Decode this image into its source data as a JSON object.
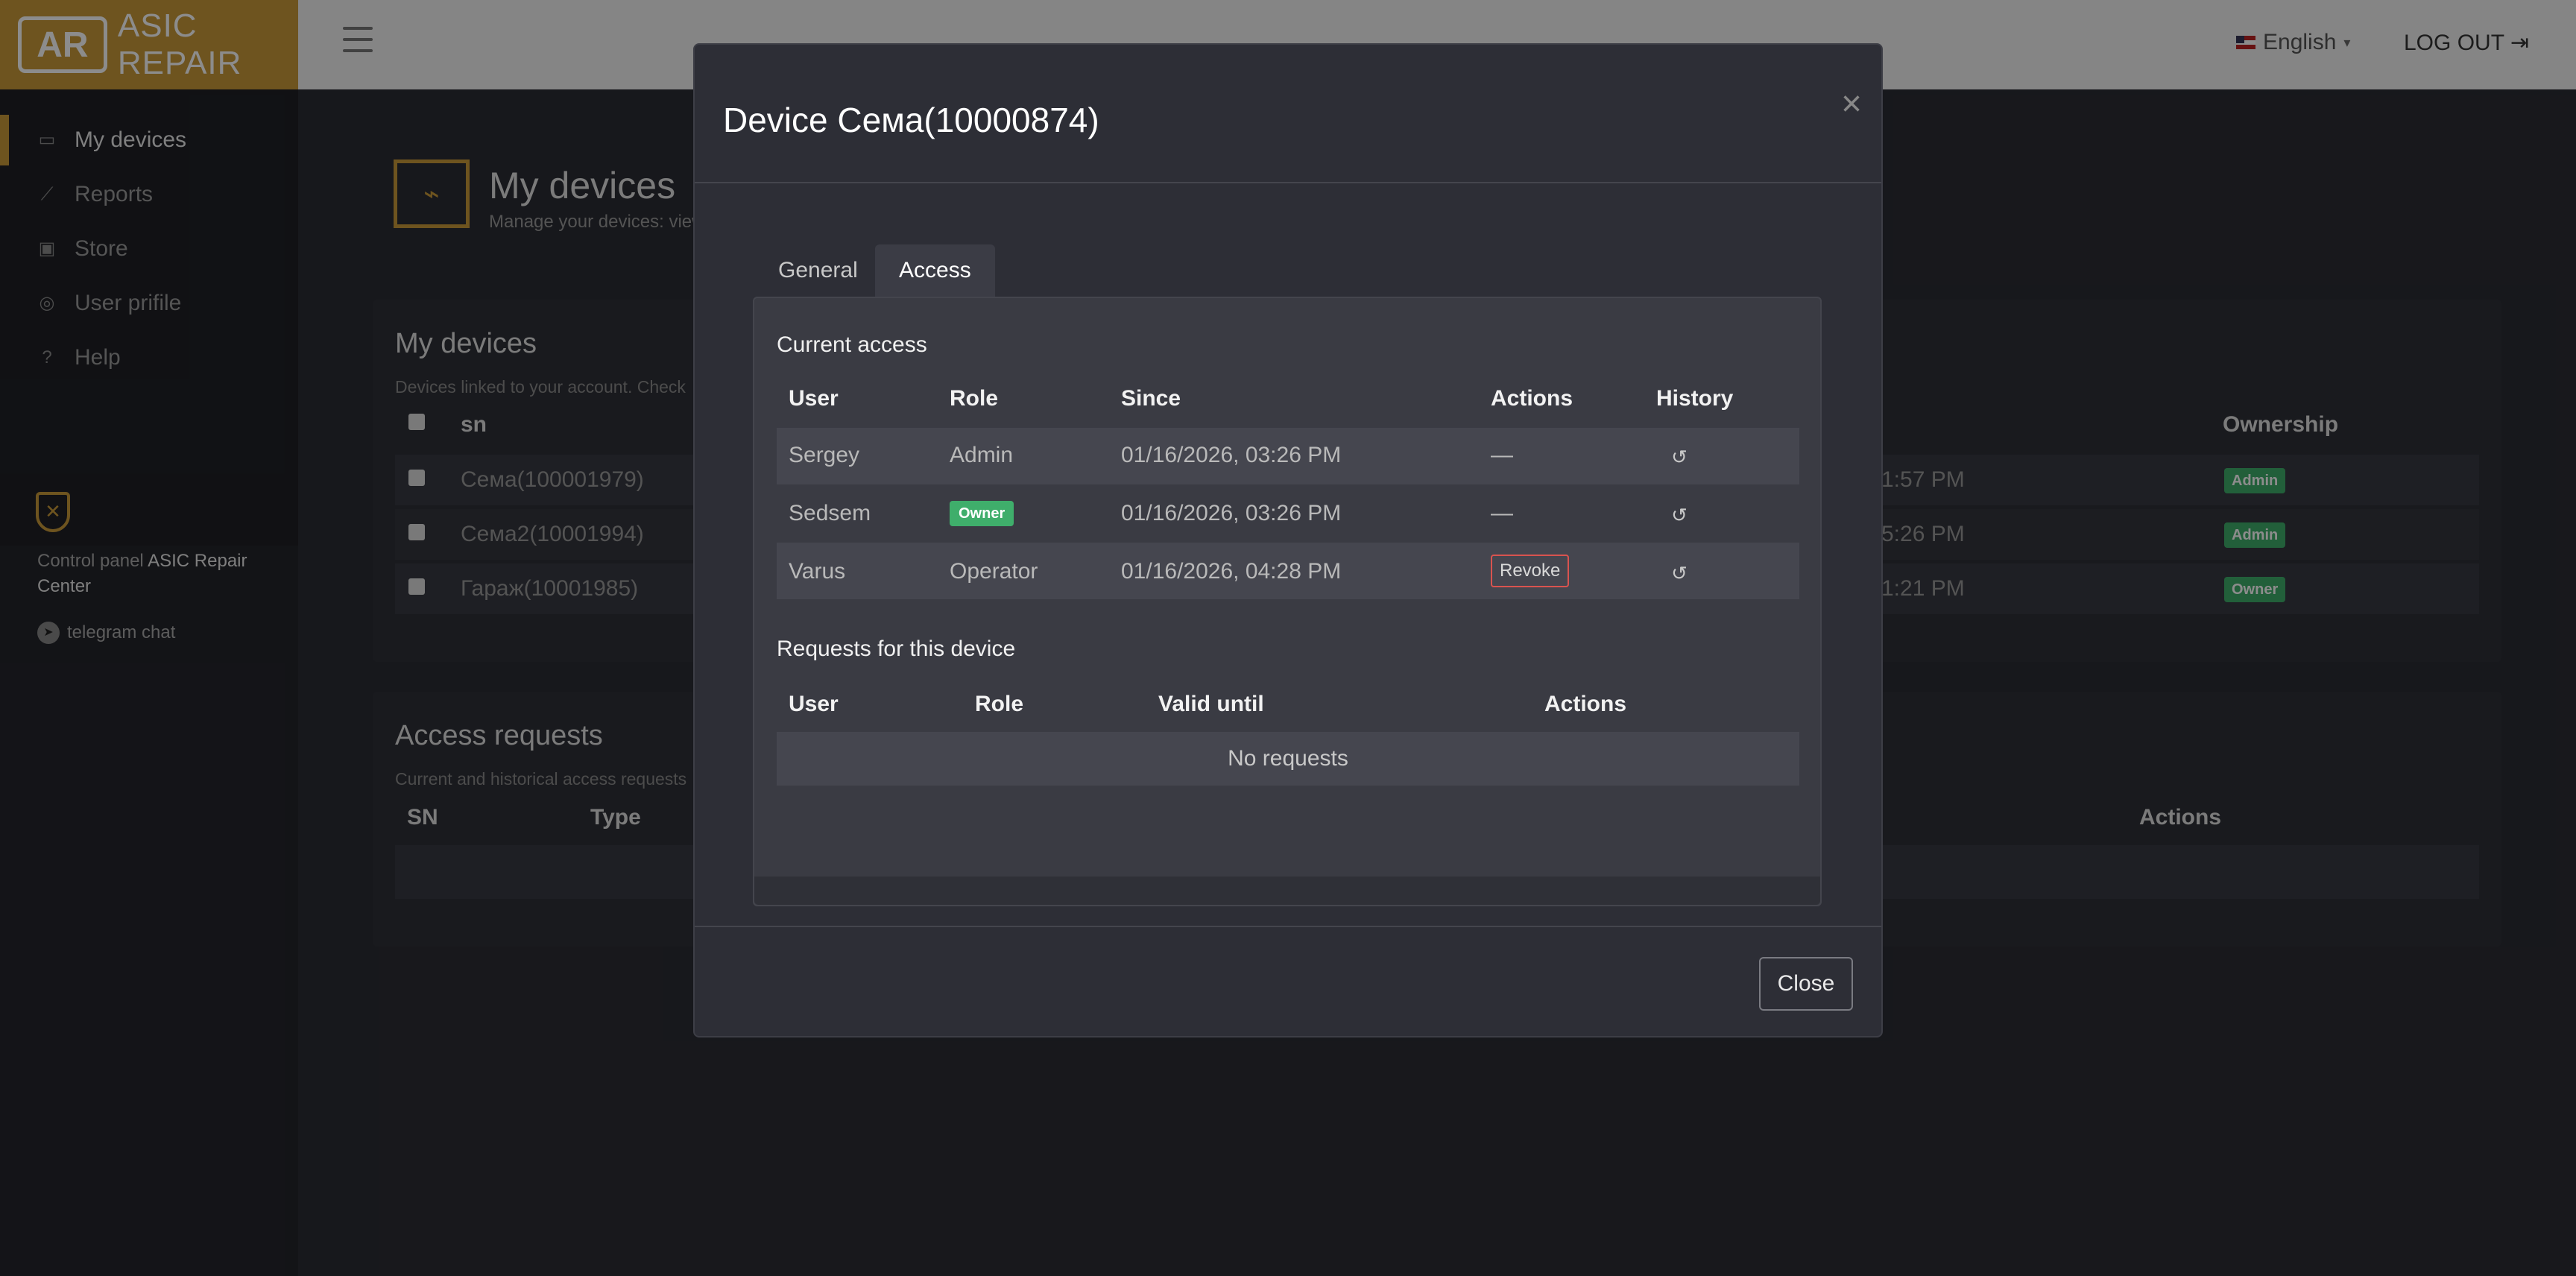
{
  "app": {
    "logo_mark": "AR",
    "logo_text": "ASIC REPAIR",
    "language": "English",
    "logout": "LOG OUT"
  },
  "sidebar": {
    "items": [
      {
        "label": "My devices",
        "icon": "monitor-icon"
      },
      {
        "label": "Reports",
        "icon": "chart-line-icon"
      },
      {
        "label": "Store",
        "icon": "store-icon"
      },
      {
        "label": "User prifile",
        "icon": "user-circle-icon"
      },
      {
        "label": "Help",
        "icon": "help-circle-icon"
      }
    ],
    "control_prefix": "Control panel",
    "control_brand": "ASIC Repair Center",
    "telegram": "telegram chat"
  },
  "page": {
    "title": "My devices",
    "subtitle": "Manage your devices: view"
  },
  "devices_card": {
    "title": "My devices",
    "note": "Devices linked to your account. Check",
    "col_sn": "sn",
    "col_ownership": "Ownership",
    "rows": [
      {
        "sn": "Сема(100001979)",
        "time": "1:57 PM",
        "ownership": "Admin"
      },
      {
        "sn": "Сема2(10001994)",
        "time": "5:26 PM",
        "ownership": "Admin"
      },
      {
        "sn": "Гараж(10001985)",
        "time": "1:21 PM",
        "ownership": "Owner"
      }
    ]
  },
  "requests_card": {
    "title": "Access requests",
    "note": "Current and historical access requests",
    "col_sn": "SN",
    "col_type": "Type",
    "col_actions": "Actions"
  },
  "modal": {
    "title": "Device Сема(10000874)",
    "close_x": "×",
    "tabs": {
      "general": "General",
      "access": "Access"
    },
    "current_access": {
      "title": "Current access",
      "headers": {
        "user": "User",
        "role": "Role",
        "since": "Since",
        "actions": "Actions",
        "history": "History"
      },
      "rows": [
        {
          "user": "Sergey",
          "role": "Admin",
          "since": "01/16/2026, 03:26 PM",
          "action": "—"
        },
        {
          "user": "Sedsem",
          "role": "Owner",
          "since": "01/16/2026, 03:26 PM",
          "action": "—"
        },
        {
          "user": "Varus",
          "role": "Operator",
          "since": "01/16/2026, 04:28 PM",
          "action": "Revoke"
        }
      ]
    },
    "requests": {
      "title": "Requests for this device",
      "headers": {
        "user": "User",
        "role": "Role",
        "valid_until": "Valid until",
        "actions": "Actions"
      },
      "empty": "No requests"
    },
    "close_button": "Close"
  }
}
